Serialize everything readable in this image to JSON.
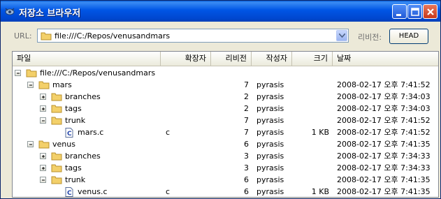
{
  "window": {
    "title": "저장소 브라우저"
  },
  "address": {
    "label": "URL:",
    "value": "file:///C:/Repos/venusandmars",
    "revision_label": "리비전:",
    "revision_button": "HEAD"
  },
  "columns": [
    "파일",
    "확장자",
    "리비전",
    "작성자",
    "크기",
    "날짜"
  ],
  "rows": [
    {
      "name": "file:///C:/Repos/venusandmars",
      "ext": "",
      "rev": "",
      "author": "",
      "size": "",
      "date": "",
      "level": 0,
      "icon": "folder-icon",
      "expander": "minus"
    },
    {
      "name": "mars",
      "ext": "",
      "rev": "7",
      "author": "pyrasis",
      "size": "",
      "date": "2008-02-17 오후 7:41:52",
      "level": 1,
      "icon": "folder-icon",
      "expander": "minus"
    },
    {
      "name": "branches",
      "ext": "",
      "rev": "2",
      "author": "pyrasis",
      "size": "",
      "date": "2008-02-17 오후 7:34:03",
      "level": 2,
      "icon": "folder-icon",
      "expander": "plus"
    },
    {
      "name": "tags",
      "ext": "",
      "rev": "2",
      "author": "pyrasis",
      "size": "",
      "date": "2008-02-17 오후 7:34:03",
      "level": 2,
      "icon": "folder-icon",
      "expander": "plus"
    },
    {
      "name": "trunk",
      "ext": "",
      "rev": "7",
      "author": "pyrasis",
      "size": "",
      "date": "2008-02-17 오후 7:41:52",
      "level": 2,
      "icon": "folder-icon",
      "expander": "minus"
    },
    {
      "name": "mars.c",
      "ext": "c",
      "rev": "7",
      "author": "pyrasis",
      "size": "1 KB",
      "date": "2008-02-17 오후 7:41:52",
      "level": 3,
      "icon": "c-file-icon",
      "expander": ""
    },
    {
      "name": "venus",
      "ext": "",
      "rev": "6",
      "author": "pyrasis",
      "size": "",
      "date": "2008-02-17 오후 7:41:35",
      "level": 1,
      "icon": "folder-icon",
      "expander": "minus"
    },
    {
      "name": "branches",
      "ext": "",
      "rev": "3",
      "author": "pyrasis",
      "size": "",
      "date": "2008-02-17 오후 7:34:33",
      "level": 2,
      "icon": "folder-icon",
      "expander": "plus"
    },
    {
      "name": "tags",
      "ext": "",
      "rev": "3",
      "author": "pyrasis",
      "size": "",
      "date": "2008-02-17 오후 7:34:33",
      "level": 2,
      "icon": "folder-icon",
      "expander": "plus"
    },
    {
      "name": "trunk",
      "ext": "",
      "rev": "6",
      "author": "pyrasis",
      "size": "",
      "date": "2008-02-17 오후 7:41:35",
      "level": 2,
      "icon": "folder-icon",
      "expander": "minus"
    },
    {
      "name": "venus.c",
      "ext": "c",
      "rev": "6",
      "author": "pyrasis",
      "size": "1 KB",
      "date": "2008-02-17 오후 7:41:35",
      "level": 3,
      "icon": "c-file-icon",
      "expander": ""
    }
  ],
  "colors": {
    "title_bar": "#0055e5",
    "folder": "#f3d06a",
    "header": "#ebeadb"
  }
}
